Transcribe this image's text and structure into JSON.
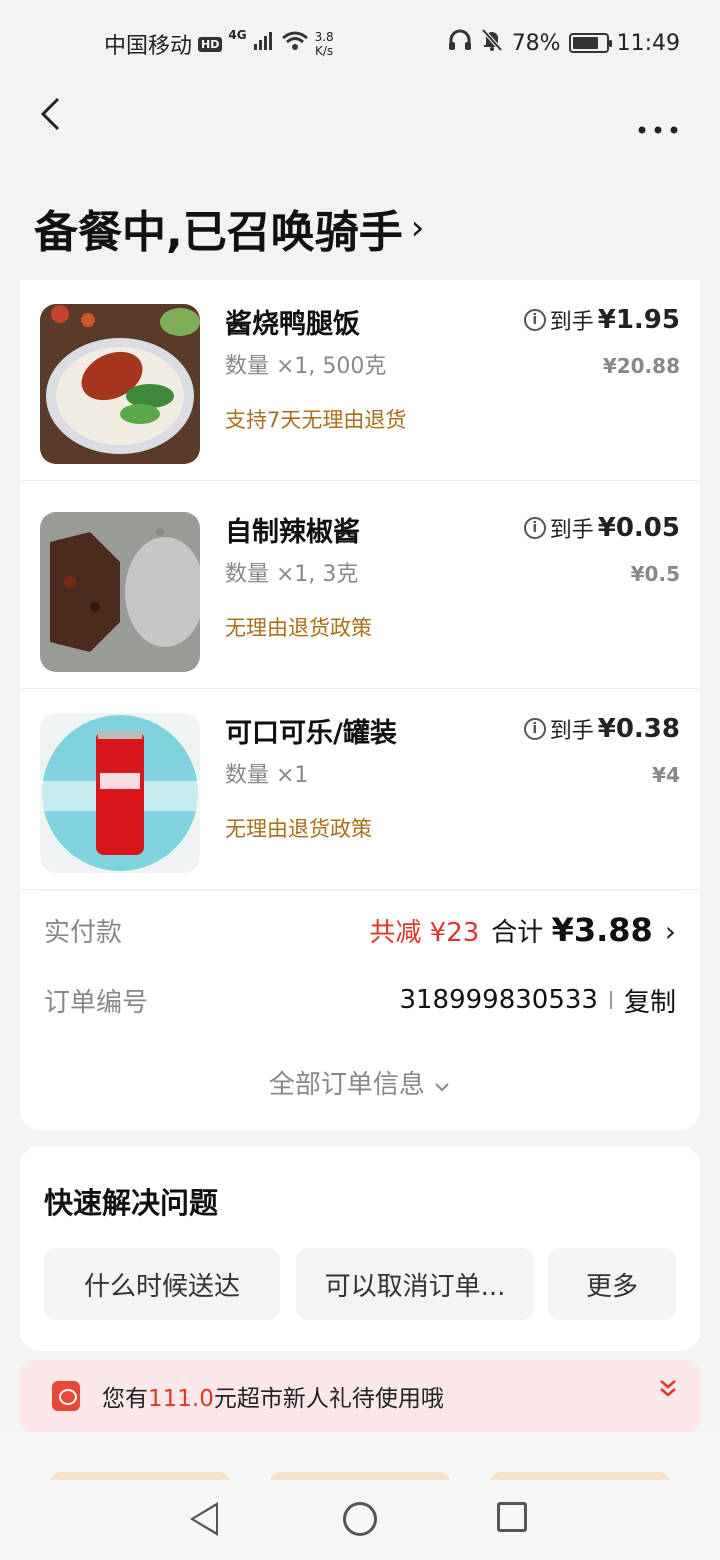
{
  "status_bar": {
    "carrier": "中国移动",
    "hd": "HD",
    "network": "4G",
    "speed_value": "3.8",
    "speed_unit": "K/s",
    "battery": "78%",
    "battery_level": 0.78,
    "time": "11:49"
  },
  "header": {
    "title": "备餐中,已召唤骑手"
  },
  "items": [
    {
      "name": "酱烧鸭腿饭",
      "qty": "数量 ×1, 500克",
      "policy": "支持7天无理由退货",
      "net_label": "到手",
      "net_price": "¥1.95",
      "orig_price": "¥20.88"
    },
    {
      "name": "自制辣椒酱",
      "qty": "数量 ×1, 3克",
      "policy": "无理由退货政策",
      "net_label": "到手",
      "net_price": "¥0.05",
      "orig_price": "¥0.5"
    },
    {
      "name": "可口可乐/罐装",
      "qty": "数量 ×1",
      "policy": "无理由退货政策",
      "net_label": "到手",
      "net_price": "¥0.38",
      "orig_price": "¥4"
    }
  ],
  "payment": {
    "label": "实付款",
    "discount": "共减 ¥23",
    "total_label": "合计",
    "total": "¥3.88"
  },
  "order": {
    "label": "订单编号",
    "number": "318999830533",
    "copy": "复制",
    "all_info": "全部订单信息"
  },
  "quick": {
    "title": "快速解决问题",
    "chips": [
      "什么时候送达",
      "可以取消订单...",
      "更多"
    ]
  },
  "banner": {
    "prefix": "您有",
    "amount": "111.0",
    "suffix": "元超市新人礼待使用哦"
  },
  "colors": {
    "accent_red": "#e0352b",
    "policy_brown": "#a8701c"
  }
}
